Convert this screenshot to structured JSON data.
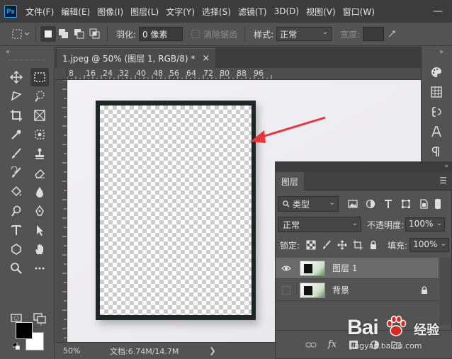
{
  "app": {
    "logo_text": "Ps"
  },
  "menu": [
    "文件(F)",
    "编辑(E)",
    "图像(I)",
    "图层(L)",
    "文字(Y)",
    "选择(S)",
    "滤镜(T)",
    "3D(D)",
    "视图(V)",
    "窗口(W)"
  ],
  "window_controls": {
    "minimize": "—",
    "maximize": "☐",
    "close": "✕"
  },
  "options_bar": {
    "feather_label": "羽化:",
    "feather_value": "0 像素",
    "antialias_label": "消除锯齿",
    "style_label": "样式:",
    "style_value": "正常",
    "width_label": "宽度:"
  },
  "document": {
    "tab_title": "1.jpeg @ 50% (图层 1, RGB/8) *",
    "close_glyph": "×"
  },
  "ruler": {
    "h_ticks": [
      "8",
      "16",
      "24",
      "32",
      "40",
      "48",
      "56",
      "64",
      "72",
      "80",
      "88",
      "96"
    ],
    "v_ticks": [
      "1",
      "2",
      "3",
      "4",
      "5",
      "6",
      "7",
      "8",
      "9",
      "10",
      "11",
      "12",
      "13",
      "14",
      "15",
      "16",
      "17",
      "18",
      "19",
      "20",
      "21",
      "22",
      "23",
      "24",
      "25",
      "26",
      "27"
    ]
  },
  "status": {
    "zoom": "50%",
    "doc_info": "文档:6.74M/14.7M",
    "arrow": "❯"
  },
  "layers_panel": {
    "tab_label": "图层",
    "filter_label": "类型",
    "blend_mode": "正常",
    "opacity_label": "不透明度:",
    "opacity_value": "100%",
    "lock_label": "锁定:",
    "fill_label": "填充:",
    "fill_value": "100%",
    "layers": [
      {
        "name": "图层 1",
        "visible": true,
        "selected": true,
        "locked": false
      },
      {
        "name": "背景",
        "visible": false,
        "selected": false,
        "locked": true
      }
    ],
    "bottom_icons": [
      "link-icon",
      "fx-icon",
      "mask-icon",
      "adjustment-icon",
      "folder-icon",
      "new-layer-icon",
      "trash-icon"
    ],
    "fx_text": "fx"
  },
  "watermark": {
    "brand": "Bai",
    "brand2": "经验",
    "url": "jingyan.baidu.com"
  },
  "colors": {
    "foreground": "#000000",
    "background": "#ffffff",
    "annotation_arrow": "#e8343a"
  }
}
